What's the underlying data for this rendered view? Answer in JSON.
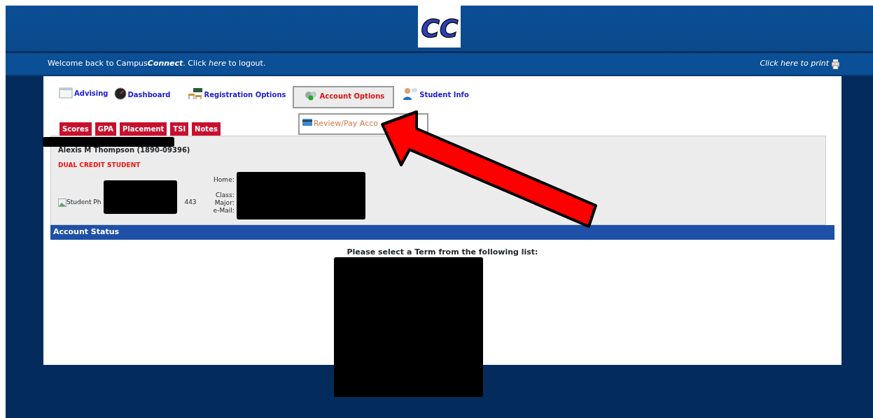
{
  "header": {
    "logo_text": "CC"
  },
  "welcome_bar": {
    "message": "Welcome back to Campus**Connect**. Click *here* to logout.",
    "print_link": "Click here to print"
  },
  "nav_tabs": [
    {
      "label": "Advising",
      "kind": "window",
      "selected": false
    },
    {
      "label": "Dashboard",
      "kind": "gauge",
      "selected": false
    },
    {
      "label": "Registration Options",
      "kind": "desks",
      "selected": false
    },
    {
      "label": "Account Options",
      "kind": "gears",
      "selected": true
    },
    {
      "label": "Student Info",
      "kind": "person",
      "selected": false
    }
  ],
  "submenu": [
    {
      "label": "Review/Pay Acco"
    }
  ],
  "sub_tabs": [
    "Scores",
    "GPA",
    "Placement",
    "TSI",
    "Notes"
  ],
  "student": {
    "name": "Alexis M Thompson (1890-09396)",
    "status": "DUAL CREDIT STUDENT",
    "photo_alt": "Student Ph",
    "id_tail": "443",
    "field_labels": [
      "Home:",
      "Class:",
      "Major:",
      "e-Mail:"
    ]
  },
  "account_status": {
    "title": "Account Status",
    "prompt": "Please select a Term from the following list:"
  }
}
